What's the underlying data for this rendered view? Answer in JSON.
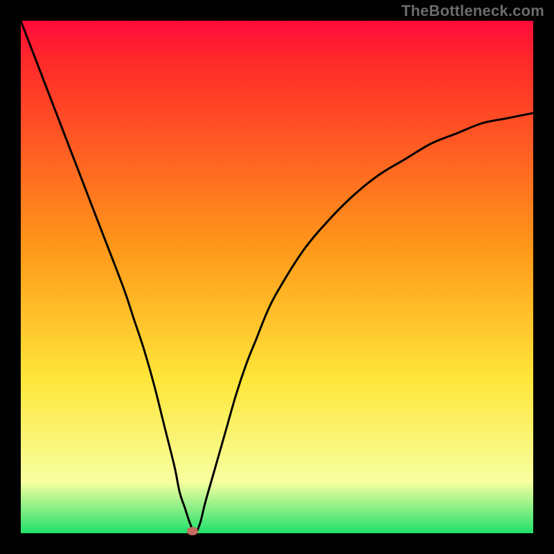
{
  "watermark": "TheBottleneck.com",
  "colors": {
    "top": "#ff0b3a",
    "red": "#ff2a2a",
    "orange": "#ff9a1a",
    "yellow": "#ffe63a",
    "pale": "#f7ffa0",
    "green": "#1fe06b",
    "curve": "#000000",
    "border": "#000000",
    "marker": "#c46a5f"
  },
  "chart_data": {
    "type": "line",
    "title": "",
    "xlabel": "",
    "ylabel": "",
    "xlim": [
      0,
      100
    ],
    "ylim": [
      0,
      100
    ],
    "x": [
      0,
      5,
      10,
      15,
      20,
      22,
      24,
      26,
      28,
      30,
      31,
      32,
      33,
      34,
      35,
      36,
      38,
      40,
      42,
      44,
      46,
      48,
      50,
      55,
      60,
      65,
      70,
      75,
      80,
      85,
      90,
      95,
      100
    ],
    "values": [
      100,
      87,
      74,
      61,
      48,
      42,
      36,
      29,
      21,
      13,
      8,
      5,
      2,
      0,
      2,
      6,
      13,
      20,
      27,
      33,
      38,
      43,
      47,
      55,
      61,
      66,
      70,
      73,
      76,
      78,
      80,
      81,
      82
    ],
    "marker": {
      "x": 33.5,
      "y": 0
    },
    "annotations": []
  }
}
